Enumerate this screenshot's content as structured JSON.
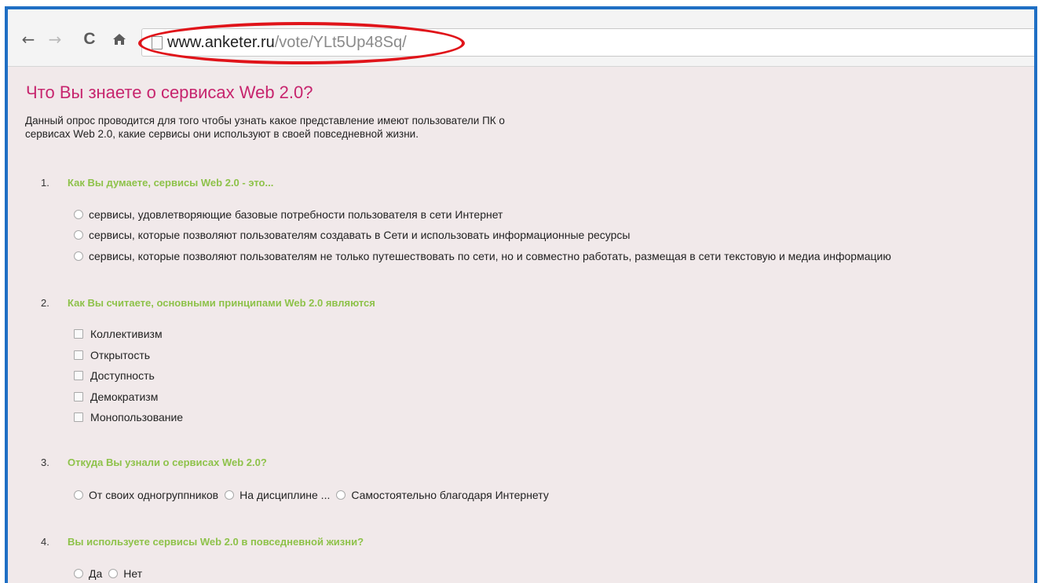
{
  "browser": {
    "url_host": "www.anketer.ru",
    "url_path": "/vote/YLt5Up48Sq/",
    "icons": [
      "back-icon",
      "forward-icon",
      "reload-icon",
      "home-icon",
      "page-icon"
    ],
    "glyphs": {
      "back": "←",
      "forward": "→",
      "reload": "C",
      "home": "🏠"
    },
    "highlight_color": "#e0141a"
  },
  "survey": {
    "title": "Что Вы знаете о сервисах Web 2.0?",
    "description": "Данный опрос проводится для того чтобы узнать какое представление имеют пользователи ПК о сервисах Web 2.0, какие сервисы они используют в своей повседневной жизни.",
    "questions": [
      {
        "num": "1.",
        "title": "Как Вы думаете, сервисы Web 2.0 - это...",
        "options": [
          "сервисы, удовлетворяющие базовые потребности пользователя в сети Интернет",
          "сервисы, которые позволяют пользователям создавать в Сети и использовать информационные ресурсы",
          "сервисы, которые позволяют пользователям не только путешествовать по сети, но и совместно работать, размещая в сети текстовую и медиа информацию"
        ]
      },
      {
        "num": "2.",
        "title": "Как Вы считаете, основными принципами Web 2.0 являются",
        "options": [
          "Коллективизм",
          "Открытость",
          "Доступность",
          "Демократизм",
          "Монопользование"
        ]
      },
      {
        "num": "3.",
        "title": "Откуда Вы узнали о сервисах Web 2.0?",
        "options": [
          "От своих одногруппников",
          "На дисциплине ...",
          "Самостоятельно благодаря Интернету"
        ]
      },
      {
        "num": "4.",
        "title": "Вы используете сервисы Web 2.0 в повседневной жизни?",
        "options": [
          "Да",
          "Нет"
        ]
      }
    ]
  },
  "colors": {
    "frame_border": "#1f6fc4",
    "page_bg": "#f1e9ea",
    "title": "#c7256e",
    "question_title": "#8ec24a"
  }
}
